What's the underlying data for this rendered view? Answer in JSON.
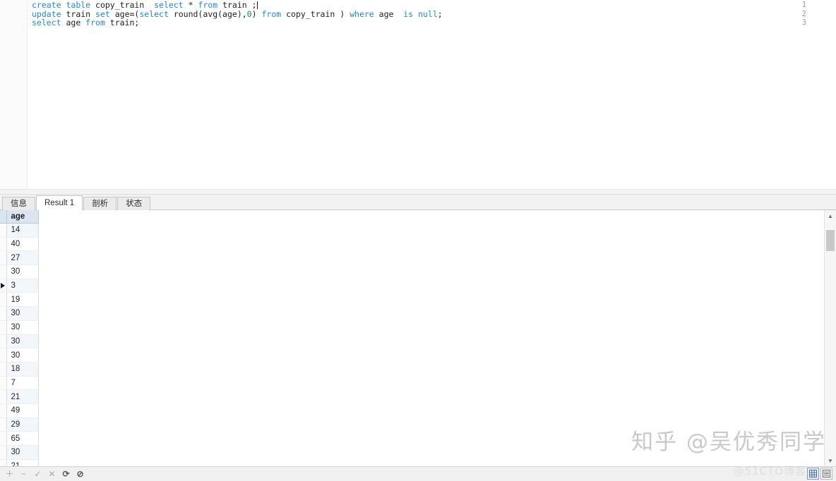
{
  "editor": {
    "line_numbers": [
      "1",
      "2",
      "3"
    ],
    "lines": [
      {
        "tokens": [
          {
            "t": "create",
            "c": "kw"
          },
          {
            "t": " ",
            "c": "pl"
          },
          {
            "t": "table",
            "c": "kw"
          },
          {
            "t": " copy_train  ",
            "c": "pl"
          },
          {
            "t": "select",
            "c": "kw"
          },
          {
            "t": " * ",
            "c": "pl"
          },
          {
            "t": "from",
            "c": "kw"
          },
          {
            "t": " train ;",
            "c": "pl"
          }
        ],
        "plain": "create table copy_train  select * from train ;"
      },
      {
        "tokens": [
          {
            "t": "update",
            "c": "kw"
          },
          {
            "t": " train ",
            "c": "pl"
          },
          {
            "t": "set",
            "c": "kw"
          },
          {
            "t": " age=(",
            "c": "pl"
          },
          {
            "t": "select",
            "c": "kw"
          },
          {
            "t": " round(avg(age),",
            "c": "pl"
          },
          {
            "t": "0",
            "c": "num"
          },
          {
            "t": ") ",
            "c": "pl"
          },
          {
            "t": "from",
            "c": "kw"
          },
          {
            "t": " copy_train ) ",
            "c": "pl"
          },
          {
            "t": "where",
            "c": "kw"
          },
          {
            "t": " age  ",
            "c": "pl"
          },
          {
            "t": "is",
            "c": "kw"
          },
          {
            "t": " ",
            "c": "pl"
          },
          {
            "t": "null",
            "c": "kw"
          },
          {
            "t": ";",
            "c": "pl"
          }
        ],
        "plain": "update train set age=(select round(avg(age),0) from copy_train ) where age  is null;"
      },
      {
        "tokens": [
          {
            "t": "select",
            "c": "kw"
          },
          {
            "t": " age ",
            "c": "pl"
          },
          {
            "t": "from",
            "c": "kw"
          },
          {
            "t": " train;",
            "c": "pl"
          }
        ],
        "plain": "select age from train;"
      }
    ],
    "cursor_line": 1
  },
  "tabs": [
    {
      "label": "信息",
      "active": false
    },
    {
      "label": "Result 1",
      "active": true
    },
    {
      "label": "剖析",
      "active": false
    },
    {
      "label": "状态",
      "active": false
    }
  ],
  "result_grid": {
    "columns": [
      "age"
    ],
    "rows": [
      {
        "age": "14",
        "current": false
      },
      {
        "age": "40",
        "current": false
      },
      {
        "age": "27",
        "current": false
      },
      {
        "age": "30",
        "current": false
      },
      {
        "age": "3",
        "current": true
      },
      {
        "age": "19",
        "current": false
      },
      {
        "age": "30",
        "current": false
      },
      {
        "age": "30",
        "current": false
      },
      {
        "age": "30",
        "current": false
      },
      {
        "age": "30",
        "current": false
      },
      {
        "age": "18",
        "current": false
      },
      {
        "age": "7",
        "current": false
      },
      {
        "age": "21",
        "current": false
      },
      {
        "age": "49",
        "current": false
      },
      {
        "age": "29",
        "current": false
      },
      {
        "age": "65",
        "current": false
      },
      {
        "age": "30",
        "current": false
      },
      {
        "age": "21",
        "current": false
      }
    ]
  },
  "scrollbar": {
    "up_arrow": "scroll-up-icon",
    "down_arrow": "scroll-down-icon"
  },
  "bottom_toolbar": {
    "icons": [
      {
        "name": "add-record-icon",
        "glyph": "＋"
      },
      {
        "name": "delete-record-icon",
        "glyph": "−"
      },
      {
        "name": "apply-changes-icon",
        "glyph": "✓"
      },
      {
        "name": "cancel-changes-icon",
        "glyph": "✕"
      },
      {
        "name": "refresh-icon",
        "glyph": "⟳"
      },
      {
        "name": "stop-icon",
        "glyph": "⊘"
      }
    ],
    "view_grid_label": "grid-view-icon",
    "view_form_label": "form-view-icon"
  },
  "watermarks": {
    "zhihu": "知乎 @吴优秀同学",
    "cto": "@51CTO博客"
  },
  "colors": {
    "keyword": "#1e88e5",
    "number": "#0d8a7a",
    "header_bg": "#dbe5f1",
    "alt_row_bg": "#f2f7fc"
  }
}
